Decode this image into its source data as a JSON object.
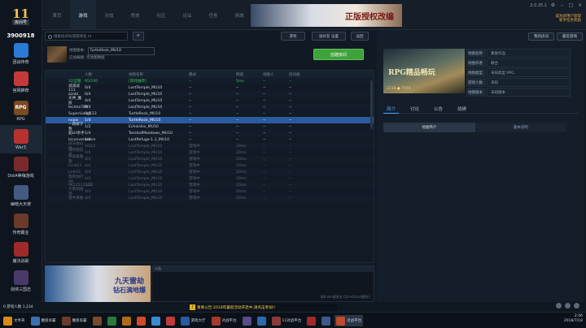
{
  "app": {
    "logo": "11",
    "logo_sub": "房间号",
    "user_id": "3900918",
    "version": "2.0.25.1",
    "promo_line1": "成为新用户获得",
    "promo_line2": "新手任务奖励"
  },
  "sidebar": [
    {
      "label": "团战传奇",
      "color": "#2a7ad6"
    },
    {
      "label": "官网推荐",
      "color": "#c43a3a"
    },
    {
      "label": "RPG",
      "color": "#7a4a20",
      "icon": "RPG"
    },
    {
      "label": "War3",
      "color": "#b8312f",
      "selected": true
    },
    {
      "label": "DotA等嗨游戏",
      "color": "#7a2a2a"
    },
    {
      "label": "幽暗大天使",
      "color": "#445a80"
    },
    {
      "label": "传奇霸业",
      "color": "#6a3a2a"
    },
    {
      "label": "魔法战歌",
      "color": "#a02a2a"
    },
    {
      "label": "剑侠三国志",
      "color": "#4a3a6a"
    }
  ],
  "top_tabs": [
    "首页",
    "游戏",
    "对战",
    "竞技",
    "社区",
    "论坛",
    "任务",
    "商城"
  ],
  "active_tab": 1,
  "banner": {
    "text": "正版授权改编"
  },
  "toolbar": {
    "search_placeholder": "搜索房间号或游戏名 Id",
    "btn1": "游戏",
    "btn2": "加好友 设置",
    "btn3": "返回"
  },
  "room": {
    "map_label": "地图版本:",
    "map_value": "TurtleRock_MU10",
    "status_label": "已加载图:",
    "status_value": "无地图数据",
    "create_label": "创建房间"
  },
  "table": {
    "headers": [
      "",
      "人数",
      "地图名称",
      "模式",
      "网速",
      "地图人",
      "房间类"
    ],
    "rows": [
      {
        "c": [
          "1D全服",
          "95/100",
          "[游戏推荐]",
          "--",
          "5ms",
          "--",
          "--"
        ],
        "s": "green"
      },
      {
        "c": [
          "减减减111",
          "0/4",
          "LostTemple_MU10",
          "--",
          "--",
          "--",
          "--"
        ]
      },
      {
        "c": [
          "zonbi",
          "0/4",
          "LostTemple_MU10",
          "--",
          "--",
          "--",
          "--"
        ]
      },
      {
        "c": [
          "天神_魔族",
          "4/4",
          "LostTemple_MU10",
          "--",
          "--",
          "--",
          "--"
        ]
      },
      {
        "c": [
          "lecime789",
          "0/4",
          "LostTemple_MU10",
          "--",
          "--",
          "--",
          "--"
        ]
      },
      {
        "c": [
          "SuperLiang123",
          "0/4",
          "TurtleRock_MU10",
          "--",
          "--",
          "--",
          "--"
        ]
      },
      {
        "c": [
          "nvpis",
          "1/4",
          "TurtleRock_MU10",
          "--",
          "--",
          "--",
          "--"
        ],
        "s": "sel"
      },
      {
        "c": [
          "一路解于我",
          "1/2",
          "Echoisles_MU10",
          "--",
          "--",
          "--",
          "--"
        ]
      },
      {
        "c": [
          "超LH杀手",
          "1/4",
          "TwistedMeadows_MU10",
          "--",
          "--",
          "--",
          "--"
        ]
      },
      {
        "c": [
          "Inconvenience",
          "1/4",
          "LastRefuge-1.1_MU10",
          "--",
          "--",
          "--",
          "--"
        ]
      },
      {
        "c": [
          "白日依山尽",
          "10/12",
          "LostTemple_MU10",
          "游戏中",
          "20ms",
          "--",
          "--"
        ],
        "s": "dim"
      },
      {
        "c": [
          "请和我较量",
          "4/4",
          "LostTemple_MU10",
          "游戏中",
          "20ms",
          "--",
          "--"
        ],
        "s": "dim"
      },
      {
        "c": [
          "小黑看着我",
          "4/4",
          "LostTemple_MU10",
          "游戏中",
          "20ms",
          "--",
          "--"
        ],
        "s": "dim"
      },
      {
        "c": [
          "lios923",
          "4/4",
          "LostTemple_MU10",
          "游戏中",
          "20ms",
          "--",
          "--"
        ],
        "s": "dim"
      },
      {
        "c": [
          "Lnkl01",
          "4/4",
          "LostTemple_MU10",
          "游戏中",
          "20ms",
          "--",
          "--"
        ],
        "s": "dim"
      },
      {
        "c": [
          "我和你打gg",
          "4/4",
          "LostTemple_MU10",
          "游戏中",
          "20ms",
          "--",
          "--"
        ],
        "s": "dim"
      },
      {
        "c": [
          "9K12511122",
          "7/12",
          "LostTemple_MU10",
          "游戏中",
          "20ms",
          "--",
          "--"
        ],
        "s": "dim"
      },
      {
        "c": [
          "大家加油吧",
          "4/4",
          "LostTemple_MU10",
          "游戏中",
          "20ms",
          "--",
          "--"
        ],
        "s": "dim"
      },
      {
        "c": [
          "夜半来看",
          "4/4",
          "LostTemple_MU10",
          "游戏中",
          "20ms",
          "--",
          "--"
        ],
        "s": "dim"
      }
    ]
  },
  "ad": {
    "t1": "九天雷劫",
    "t2": "钻石满地爆"
  },
  "chat": {
    "title": "公告",
    "hint": "按Enter键发送 Ctrl+Enter键换行"
  },
  "right": {
    "btn1": "我的房间",
    "btn2": "最近游戏",
    "game_title": "RPG精品畅玩",
    "game_stats": "2238 ● 7974",
    "info": [
      {
        "k": "地图名称",
        "v": "重复作品"
      },
      {
        "k": "地图作者",
        "v": "联合"
      },
      {
        "k": "地图类型",
        "v": "未知类型 RPG"
      },
      {
        "k": "游戏人数",
        "v": "未知"
      },
      {
        "k": "地图版本",
        "v": "未知版本"
      }
    ],
    "tabs": [
      "简介",
      "讨论",
      "公告",
      "战绩"
    ],
    "subtabs": [
      "地图简介",
      "版本说明"
    ]
  },
  "taskbar": {
    "left": "0 游戏人数 1,234",
    "notice": "重要公告:2018年暑假活动开启中,请点击参加!!",
    "apps": [
      "文件夹",
      "魔兽争霸",
      "魔兽争霸",
      "",
      "",
      "",
      "",
      "",
      "",
      "游戏大厅",
      "对战平台",
      "",
      "",
      "11对战平台",
      "",
      "",
      "对战平台"
    ],
    "time": "2:46",
    "date": "2018/7/18"
  }
}
